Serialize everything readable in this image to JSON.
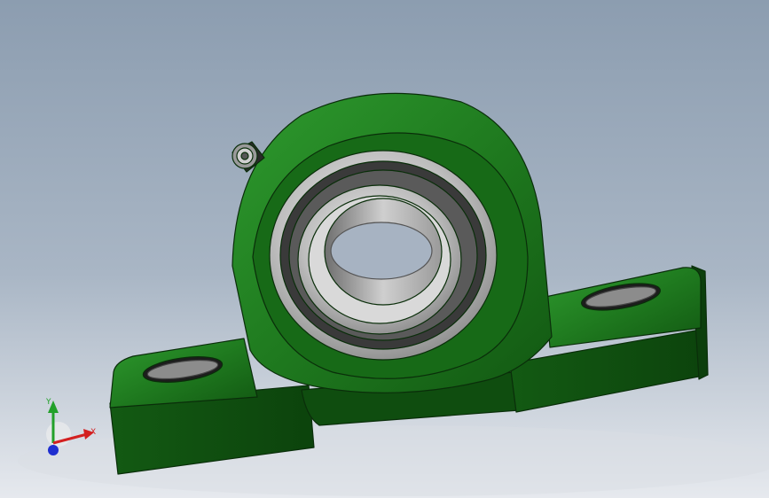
{
  "model": {
    "part": "pillow-block-bearing",
    "colors": {
      "housing": "#1f7a1f",
      "housing_dark": "#0f4d0f",
      "housing_edge": "#0a2e0a",
      "bearing_steel": "#c7c7c7",
      "bearing_dark": "#3a3a3a",
      "background_top": "#8c9db0",
      "background_bottom": "#e6e9ee"
    }
  },
  "triad": {
    "x_label": "X",
    "y_label": "Y",
    "x_color": "#d32020",
    "y_color": "#22a02a",
    "z_color": "#1f2fd0"
  }
}
